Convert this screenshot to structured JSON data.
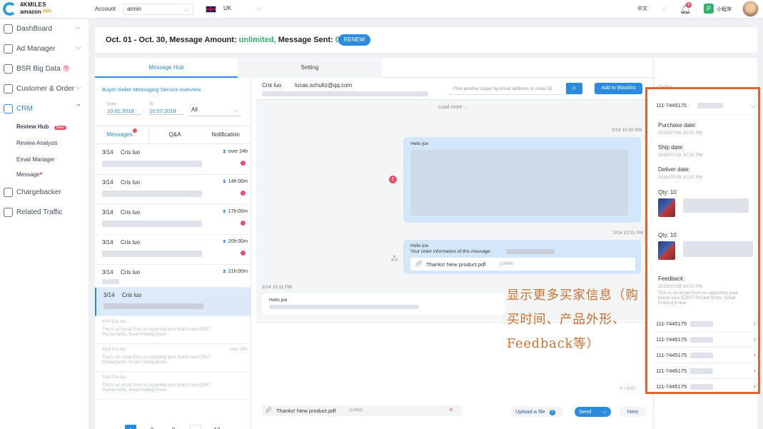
{
  "brand": {
    "line1": "4KMILES",
    "line2": "amazon",
    "line3": "ppc"
  },
  "topbar": {
    "account_label": "Account",
    "account_value": "armin",
    "region_value": "UK",
    "lang_value": "中文",
    "notif_count": "9",
    "mini_program": "小程序"
  },
  "sidebar": {
    "items": [
      {
        "label": "DashBoard"
      },
      {
        "label": "Ad Manager"
      },
      {
        "label": "BSR Big Data"
      },
      {
        "label": "Customer & Order"
      },
      {
        "label": "CRM"
      },
      {
        "label": "Chargebacker"
      },
      {
        "label": "Related Traffic"
      }
    ],
    "crm_sub": [
      {
        "label": "Review Hub",
        "badge": "New"
      },
      {
        "label": "Review Analysis"
      },
      {
        "label": "Email Manager"
      },
      {
        "label": "Message"
      }
    ]
  },
  "header": {
    "range": "Oct. 01 - Oct. 30, Message",
    "amount_label": "Amount:",
    "amount_value": "unlimited,",
    "sent_label": "Message Sent:",
    "sent_value": "0.",
    "renew": "RENEW"
  },
  "tabs": {
    "hub": "Message Hub",
    "setting": "Setting"
  },
  "left": {
    "overview_link": "Buyer-Seller Messaging Service overview",
    "from_label": "From",
    "from_value": "10.01.2018",
    "to_label": "To",
    "to_value": "10.07.2018",
    "filter_value": "All",
    "subtabs": [
      "Messages",
      "Q&A",
      "Notification"
    ],
    "messages": [
      {
        "date": "3/14",
        "name": "Cris luo",
        "time": "over 24h"
      },
      {
        "date": "3/14",
        "name": "Cris luo",
        "time": "14h:00m"
      },
      {
        "date": "3/14",
        "name": "Cris luo",
        "time": "17h:00m"
      },
      {
        "date": "3/14",
        "name": "Cris luo",
        "time": "20h:00m"
      },
      {
        "date": "3/14",
        "name": "Cris luo",
        "time": "21h:00m"
      },
      {
        "date": "3/14",
        "name": "Cris luo",
        "time": ""
      }
    ],
    "faded": [
      {
        "head": "3/14   Cris luo",
        "time": "",
        "body": "This is an email from us regarding your brand new EZKIT Pocket Knife, Small Folding Knive"
      },
      {
        "head": "3/14   Cris luo",
        "time": "over 24h",
        "body": "This is an email from us regarding your brand new EZKIT Pocket Knife, Small Folding Knive"
      },
      {
        "head": "3/14   Cris luo",
        "time": "",
        "body": "This is an email from us regarding your brand new EZKIT Pocket Knife, Small Folding Knive"
      }
    ],
    "pages": [
      "1",
      "2",
      "3",
      "...",
      "12"
    ]
  },
  "chat": {
    "name": "Cris luo",
    "email": "lucas.schultz@qq.com",
    "search_placeholder": "Find another buyer by email address or order ID",
    "blacklist": "Add to Blacklist",
    "load_more": "Load more",
    "msg1_time": "3/14 10:30 PM",
    "msg1_greeting": "Hello joe",
    "msg2_time": "3/14 10:31 PM",
    "msg2_greeting": "Hello joe",
    "msg2_line": "Your order information of this message:",
    "attachment": "Thanks! New product.pdf",
    "attachment_size": "(3.86M)",
    "msg3_time": "3/14 10:11 PM",
    "msg3_greeting": "Hello joe",
    "counter": "0 / 4000",
    "compose_attachment": "Thanks! New product.pdf",
    "compose_size": "(3.86M)",
    "upload": "Upload a file",
    "send": "Send",
    "next": "Next"
  },
  "orders": {
    "title": "Order",
    "first": "111-7445175",
    "purchase_label": "Purchase date:",
    "purchase_value": "2018/07/08 10:32 PM",
    "ship_label": "Ship date:",
    "ship_value": "2018/07/08 10:32 PM",
    "deliver_label": "Deliver date:",
    "deliver_value": "2018/07/08 10:32 PM",
    "qty1": "Qty: 10",
    "qty2": "Qty: 10",
    "feedback_label": "Feedback:",
    "feedback_date": "2018/07/08 10:32 PM",
    "feedback_text": "This is an email from us regarding your brand new EZKIT Pocket Knife, Small Folding Knive",
    "list": [
      "111-7445175",
      "111-7445175",
      "111-7445175",
      "111-7445175",
      "111-7445175"
    ]
  },
  "annotation": "显示更多买家信息（购买时间、产品外形、Feedback等）"
}
